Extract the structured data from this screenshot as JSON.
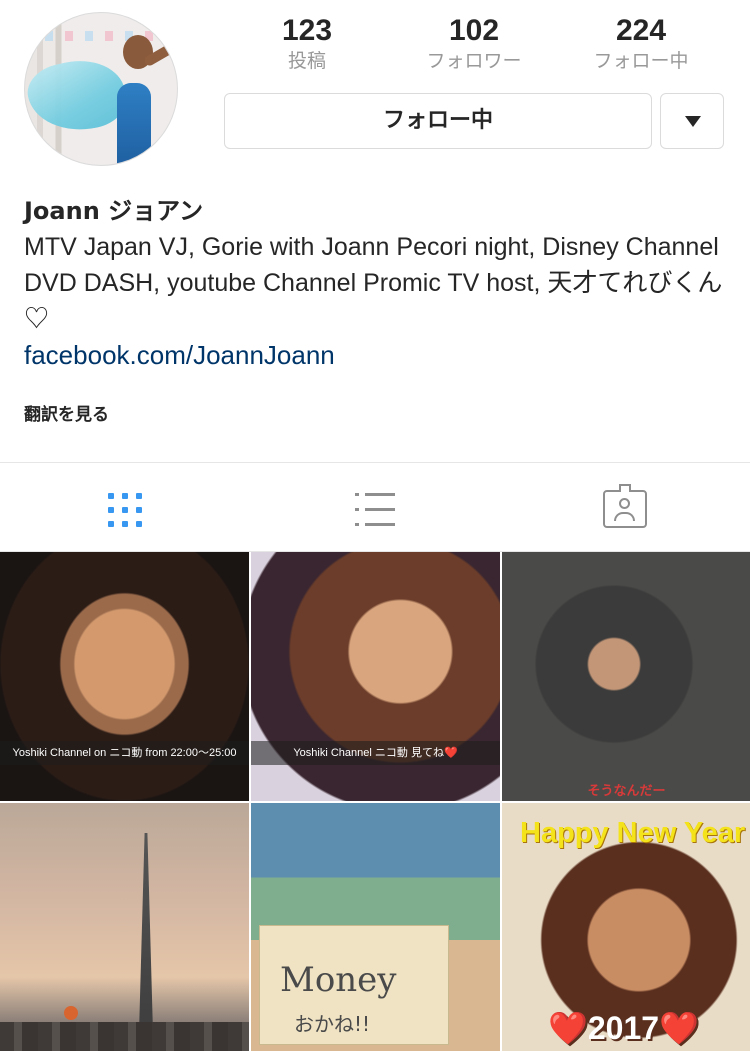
{
  "profile": {
    "name": "Joann ジョアン",
    "bio": "MTV Japan VJ, Gorie with Joann Pecori night, Disney Channel DVD DASH, youtube Channel Promic TV host, 天才てれびくん♡",
    "link": "facebook.com/JoannJoann",
    "translate_label": "翻訳を見る"
  },
  "stats": {
    "posts": {
      "value": "123",
      "label": "投稿"
    },
    "followers": {
      "value": "102",
      "label": "フォロワー"
    },
    "following": {
      "value": "224",
      "label": "フォロー中"
    }
  },
  "actions": {
    "follow_label": "フォロー中",
    "dropdown_icon": "caret-down-icon"
  },
  "tabs": [
    {
      "name": "grid",
      "icon": "grid-icon",
      "active": true
    },
    {
      "name": "list",
      "icon": "list-icon",
      "active": false
    },
    {
      "name": "tagged",
      "icon": "tagged-photos-icon",
      "active": false
    }
  ],
  "posts": [
    {
      "caption": "Yoshiki Channel on ニコ動 from 22:00〜25:00"
    },
    {
      "caption": "Yoshiki  Channel ニコ動 見てね❤️"
    },
    {
      "caption": "そうなんだー"
    },
    {
      "caption": ""
    },
    {
      "caption": "Moneyおかね!!",
      "line1": "Money",
      "line2": "おかね!!"
    },
    {
      "caption": "Happy New Year ❤️2017❤️",
      "line1": "Happy New Year",
      "line2": "❤️2017❤️"
    }
  ],
  "colors": {
    "accent": "#3897f0",
    "link": "#003569",
    "muted": "#999999",
    "border": "#dbdbdb"
  }
}
